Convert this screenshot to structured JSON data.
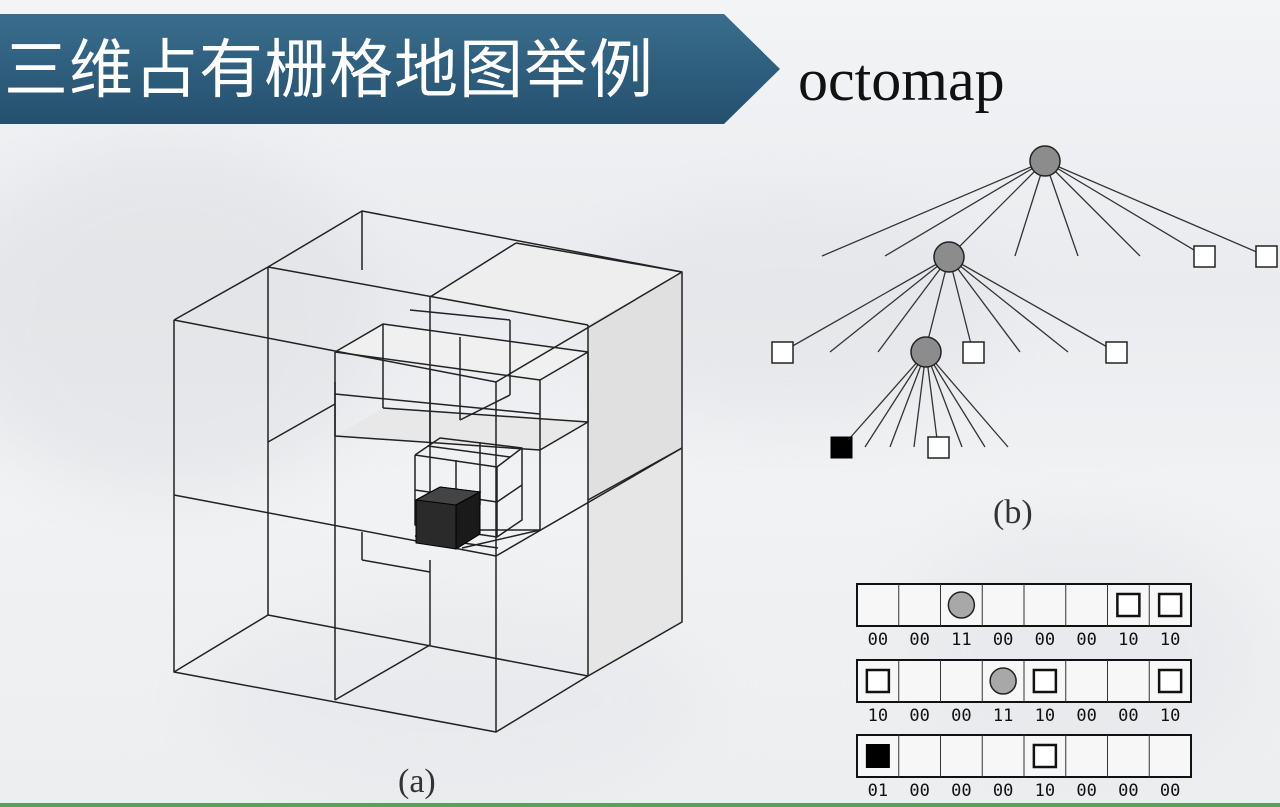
{
  "slide": {
    "title": "三维占有栅格地图举例",
    "subtitle": "octomap",
    "caption_a": "(a)",
    "caption_b": "(b)"
  },
  "colors": {
    "banner": "#2f5f7f",
    "banner_dark": "#244c67",
    "node_gray": "#8c8c8c",
    "occupied": "#000000",
    "line": "#222222"
  },
  "bit_rows": [
    {
      "cells": [
        "empty",
        "empty",
        "inner",
        "empty",
        "empty",
        "empty",
        "free",
        "free"
      ],
      "codes": [
        "00",
        "00",
        "11",
        "00",
        "00",
        "00",
        "10",
        "10"
      ]
    },
    {
      "cells": [
        "free",
        "empty",
        "empty",
        "inner",
        "free",
        "empty",
        "empty",
        "free"
      ],
      "codes": [
        "10",
        "00",
        "00",
        "11",
        "10",
        "00",
        "00",
        "10"
      ]
    },
    {
      "cells": [
        "occupied",
        "empty",
        "empty",
        "empty",
        "free",
        "empty",
        "empty",
        "empty"
      ],
      "codes": [
        "01",
        "00",
        "00",
        "00",
        "10",
        "00",
        "00",
        "00"
      ]
    }
  ]
}
